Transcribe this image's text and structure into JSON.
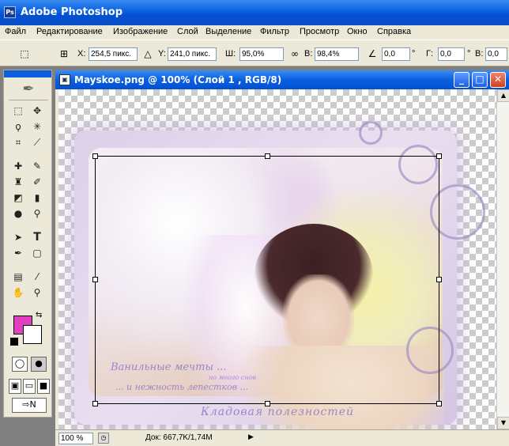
{
  "app": {
    "title": "Adobe Photoshop",
    "icon_label": "Ps"
  },
  "menu": [
    "Файл",
    "Редактирование",
    "Изображение",
    "Слой",
    "Выделение",
    "Фильтр",
    "Просмотр",
    "Окно",
    "Справка"
  ],
  "options": {
    "x_label": "X:",
    "x_value": "254,5 пикс.",
    "y_label": "Y:",
    "y_value": "241,0 пикс.",
    "w_label": "Ш:",
    "w_value": "95,0%",
    "h_label": "В:",
    "h_value": "98,4%",
    "angle_value": "0,0",
    "angle_unit": "°",
    "hskew_label": "Г:",
    "hskew_value": "0,0",
    "hskew_unit": "°",
    "vskew_label": "В:",
    "vskew_value": "0,0"
  },
  "document": {
    "title": "Mayskoe.png @ 100% (Слой 1 , RGB/8)",
    "zoom": "100 %",
    "doc_info": "Док: 667,7K/1,74M"
  },
  "artwork": {
    "line1": "Ванильные мечты ...",
    "line2": "но много снов",
    "line3": "... и нежность лепестков ...",
    "footer": "Кладовая полезностей"
  },
  "colors": {
    "foreground": "#e040c0",
    "background": "#ffffff",
    "titlebar": "#0a5fe0"
  },
  "icons": {
    "move": "move-icon",
    "marquee": "marquee-icon",
    "lasso": "lasso-icon",
    "magic-wand": "magic-wand-icon",
    "crop": "crop-icon",
    "slice": "slice-icon",
    "healing": "healing-icon",
    "brush": "brush-icon",
    "stamp": "stamp-icon",
    "history-brush": "history-brush-icon",
    "eraser": "eraser-icon",
    "gradient": "gradient-icon",
    "blur": "blur-icon",
    "dodge": "dodge-icon",
    "path-select": "path-select-icon",
    "type": "type-icon",
    "pen": "pen-icon",
    "shape": "shape-icon",
    "notes": "notes-icon",
    "eyedropper": "eyedropper-icon",
    "hand": "hand-icon",
    "zoom": "zoom-icon"
  }
}
